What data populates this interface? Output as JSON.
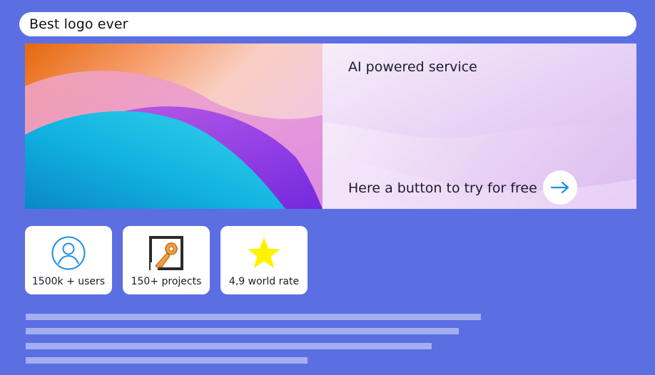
{
  "header": {
    "title": "Best logo ever"
  },
  "hero": {
    "headline": "AI powered service",
    "cta_text": "Here a button to try for free",
    "cta_icon": "arrow-right-icon"
  },
  "stats": {
    "users": {
      "label": "1500k + users",
      "icon": "user-icon"
    },
    "projects": {
      "label": "150+ projects",
      "icon": "key-icon"
    },
    "rate": {
      "label": "4,9 world rate",
      "icon": "star-icon"
    }
  },
  "colors": {
    "background": "#5b6fe2",
    "card": "#ffffff",
    "accent": "#1e90e6",
    "placeholder": "#a4afef",
    "star": "#fff200"
  }
}
